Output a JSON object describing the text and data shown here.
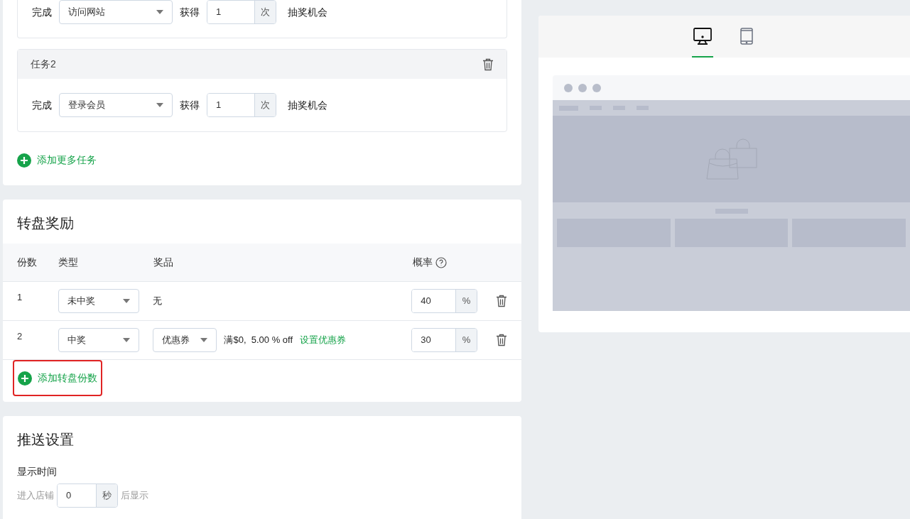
{
  "tasks": [
    {
      "label_complete": "完成",
      "action": "访问网站",
      "label_get": "获得",
      "count": "1",
      "unit": "次",
      "suffix": "抽奖机会"
    },
    {
      "title": "任务2",
      "label_complete": "完成",
      "action": "登录会员",
      "label_get": "获得",
      "count": "1",
      "unit": "次",
      "suffix": "抽奖机会"
    }
  ],
  "add_task": {
    "label": "添加更多任务",
    "highlighted": false
  },
  "rewards": {
    "title": "转盘奖励",
    "columns": [
      "份数",
      "类型",
      "奖品",
      "概率"
    ],
    "rows": [
      {
        "number": "1",
        "type": "未中奖",
        "kind": "text",
        "prize": "无",
        "rate": "40",
        "unit": "%"
      },
      {
        "number": "2",
        "type": "中奖",
        "kind": "coupon",
        "prize": "优惠券",
        "detail": "满$0,  5.00 % off",
        "link": "设置优惠券",
        "rate": "30",
        "unit": "%"
      }
    ],
    "add": {
      "label": "添加转盘份数",
      "highlighted": true
    }
  },
  "push": {
    "title": "推送设置",
    "field_label": "显示时间",
    "prefix": "进入店铺",
    "value": "0",
    "unit": "秒",
    "suffix": "后显示"
  },
  "preview_tabs": [
    {
      "kind": "desktop",
      "selected": true
    },
    {
      "kind": "tablet",
      "selected": false
    }
  ]
}
